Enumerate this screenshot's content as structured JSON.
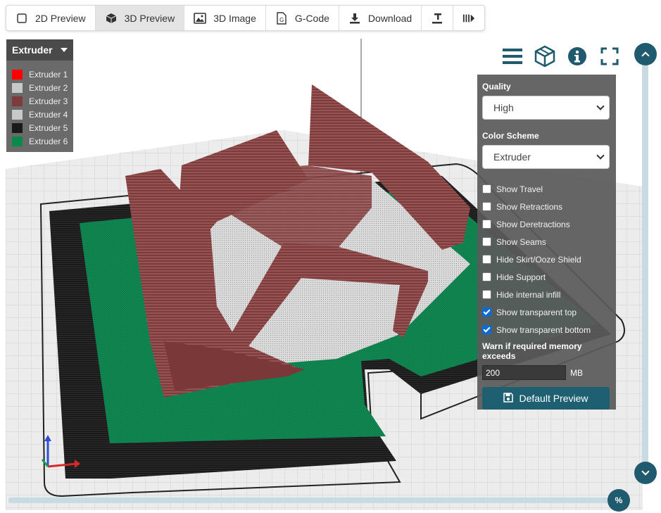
{
  "toolbar": {
    "items": [
      {
        "label": "2D Preview",
        "icon": "square-icon"
      },
      {
        "label": "3D Preview",
        "icon": "cube-icon"
      },
      {
        "label": "3D Image",
        "icon": "image-icon"
      },
      {
        "label": "G-Code",
        "icon": "gcode-file-icon"
      },
      {
        "label": "Download",
        "icon": "download-icon"
      },
      {
        "label": "",
        "icon": "layer-to-plate-icon"
      },
      {
        "label": "",
        "icon": "play-bars-icon"
      }
    ],
    "active": "3D Preview"
  },
  "legend": {
    "title": "Extruder",
    "items": [
      {
        "label": "Extruder 1",
        "color": "#ff0000"
      },
      {
        "label": "Extruder 2",
        "color": "#c8c8c8"
      },
      {
        "label": "Extruder 3",
        "color": "#7f3b3b"
      },
      {
        "label": "Extruder 4",
        "color": "#c8c8c8"
      },
      {
        "label": "Extruder 5",
        "color": "#1a1a1a"
      },
      {
        "label": "Extruder 6",
        "color": "#0a8a4a"
      }
    ]
  },
  "top_right_icons": [
    "menu-icon",
    "cube-outline-icon",
    "info-icon",
    "fullscreen-icon"
  ],
  "panel": {
    "quality_label": "Quality",
    "quality_value": "High",
    "color_scheme_label": "Color Scheme",
    "color_scheme_value": "Extruder",
    "options": [
      {
        "label": "Show Travel",
        "checked": false
      },
      {
        "label": "Show Retractions",
        "checked": false
      },
      {
        "label": "Show Deretractions",
        "checked": false
      },
      {
        "label": "Show Seams",
        "checked": false
      },
      {
        "label": "Hide Skirt/Ooze Shield",
        "checked": false
      },
      {
        "label": "Hide Support",
        "checked": false
      },
      {
        "label": "Hide internal infill",
        "checked": false
      },
      {
        "label": "Show transparent top",
        "checked": true
      },
      {
        "label": "Show transparent bottom",
        "checked": true
      }
    ],
    "memory_label": "Warn if required memory exceeds",
    "memory_value": "200",
    "memory_unit": "MB",
    "default_button": "Default Preview"
  },
  "sliders": {
    "horizontal_badge": "%"
  },
  "colors": {
    "accent": "#1f5a6e",
    "roof": "#7f3b3b",
    "wall": "#d9d9d9",
    "base": "#0a7a48",
    "skirt": "#1a1a1a",
    "bed": "#e6e6e6"
  }
}
